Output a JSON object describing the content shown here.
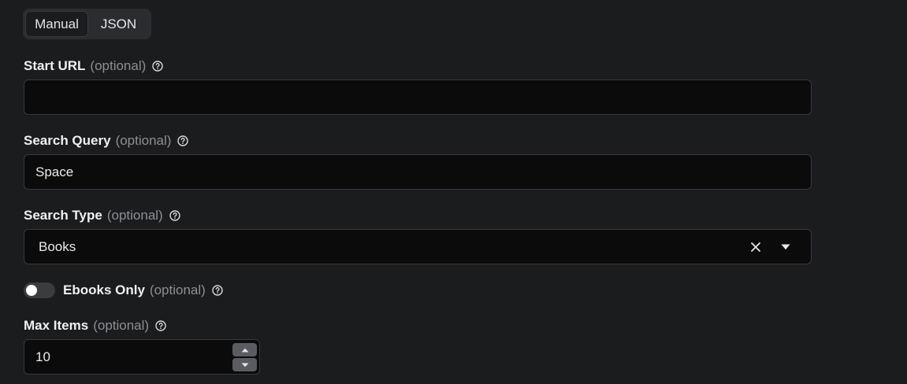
{
  "tabs": [
    {
      "label": "Manual",
      "active": true
    },
    {
      "label": "JSON",
      "active": false
    }
  ],
  "fields": {
    "start_url": {
      "label": "Start URL",
      "optional": "(optional)",
      "value": ""
    },
    "search_query": {
      "label": "Search Query",
      "optional": "(optional)",
      "value": "Space"
    },
    "search_type": {
      "label": "Search Type",
      "optional": "(optional)",
      "value": "Books"
    },
    "ebooks_only": {
      "label": "Ebooks Only",
      "optional": "(optional)",
      "checked": false
    },
    "max_items": {
      "label": "Max Items",
      "optional": "(optional)",
      "value": "10"
    }
  },
  "icons": {
    "help": "question-circle-icon",
    "clear": "close-icon",
    "caret": "caret-down-icon",
    "step_up": "caret-up-icon",
    "step_down": "caret-down-icon"
  },
  "colors": {
    "background": "#1b1c1e",
    "input_bg": "#0b0b0c",
    "border": "#38393c",
    "muted_text": "#8c8f94"
  }
}
